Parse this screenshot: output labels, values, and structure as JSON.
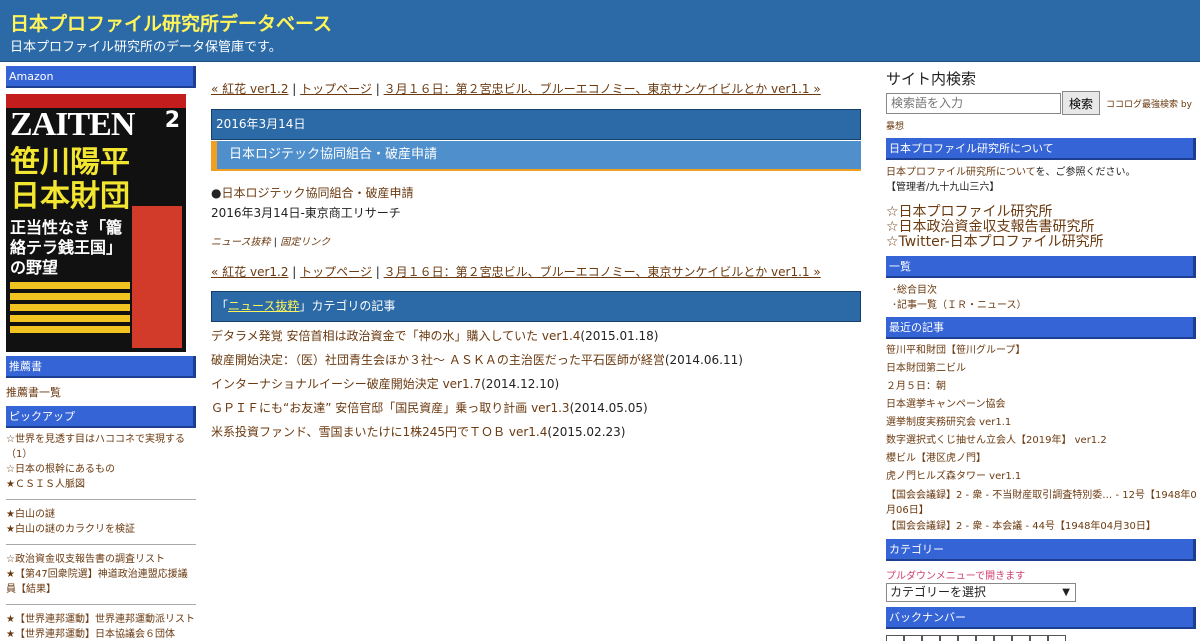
{
  "header": {
    "title": "日本プロファイル研究所データベース",
    "description": "日本プロファイル研究所のデータ保管庫です。"
  },
  "colors": {
    "header_bg": "#2b6aa6",
    "title_yellow": "#fff45a",
    "sidebar_bar": "#3464d6",
    "accent_orange": "#f0a020",
    "link_brown": "#6b3a10"
  },
  "left_sidebar": {
    "amazon_label": "Amazon",
    "magazine": {
      "logo": "ZAITEN",
      "issue": "2",
      "headline_1": "笹川陽平",
      "headline_2": "日本財団",
      "subline": "正当性なき「籠絡テラ銭王国」の野望"
    },
    "recommended_label": "推薦書",
    "recommended_link": "推薦書一覧",
    "pickup_label": "ピックアップ",
    "pickup_group1": [
      "☆世界を見透す目はハココネで実現する（1）",
      "☆日本の根幹にあるもの",
      "★ＣＳＩＳ人脈図"
    ],
    "pickup_group2": [
      "★白山の謎",
      "★白山の謎のカラクリを検証"
    ],
    "pickup_group3": [
      "☆政治資金収支報告書の調査リスト",
      "★【第47回衆院選】神道政治連盟応援議員【結果】"
    ],
    "pickup_group4": [
      "★【世界連邦運動】世界連邦運動派リスト",
      "★【世界連邦運動】日本協議会６団体"
    ]
  },
  "main": {
    "nav": {
      "prev": "« 紅花 ver1.2",
      "sep1": " | ",
      "top": "トップページ",
      "sep2": " | ",
      "next": "３月１６日：第２宮忠ビル、ブルーエコノミー、東京サンケイビルとか ver1.1 »"
    },
    "date": "2016年3月14日",
    "entry_title": "日本ロジテック協同組合・破産申請",
    "entry_bullet": "●",
    "entry_link": "日本ロジテック協同組合・破産申請",
    "entry_source": "2016年3月14日-東京商工リサーチ",
    "meta_category": "ニュース抜粋",
    "meta_sep": " | ",
    "meta_permalink": "固定リンク",
    "category_prefix": "「",
    "category_name": "ニュース抜粋",
    "category_suffix": "」カテゴリの記事",
    "articles": [
      {
        "title": "デタラメ発覚 安倍首相は政治資金で「神の水」購入していた ver1.4",
        "date": "(2015.01.18)"
      },
      {
        "title": "破産開始決定：（医）社団青生会ほか３社～ ＡＳＫＡの主治医だった平石医師が経営",
        "date": "(2014.06.11)"
      },
      {
        "title": "インターナショナルイーシー破産開始決定 ver1.7",
        "date": "(2014.12.10)"
      },
      {
        "title": "ＧＰＩＦにも“お友達” 安倍官邸「国民資産」乗っ取り計画 ver1.3",
        "date": "(2014.05.05)"
      },
      {
        "title": "米系投資ファンド、雪国まいたけに1株245円でＴＯＢ ver1.4",
        "date": "(2015.02.23)"
      }
    ]
  },
  "right_sidebar": {
    "search_title": "サイト内検索",
    "search_placeholder": "検索語を入力",
    "search_button": "検索",
    "powered_a": "ココログ最強検索",
    "powered_b": " by",
    "powered_c": "暴想",
    "about_label": "日本プロファイル研究所について",
    "about_link": "日本プロファイル研究所について",
    "about_text": "を、ご参照ください。",
    "admin": "【管理者/九十九山三六】",
    "big_links": [
      "☆日本プロファイル研究所",
      "☆日本政治資金収支報告書研究所",
      "☆Twitter-日本プロファイル研究所"
    ],
    "list_label": "一覧",
    "list_items": [
      "･総合目次",
      "･記事一覧（ＩＲ・ニュース）"
    ],
    "recent_label": "最近の記事",
    "recent_items": [
      "笹川平和財団【笹川グループ】",
      "日本財団第二ビル",
      "２月５日：朝",
      "日本選挙キャンペーン協会",
      "選挙制度実務研究会 ver1.1",
      "数字選択式くじ抽せん立会人【2019年】 ver1.2",
      "櫻ビル【港区虎ノ門】",
      "虎ノ門ヒルズ森タワー ver1.1",
      "【国会会議録】2 - 衆 - 不当財産取引調査特別委… - 12号【1948年04",
      "月06日】",
      "【国会会議録】2 - 衆 - 本会議 - 44号【1948年04月30日】"
    ],
    "category_label": "カテゴリー",
    "category_note": "プルダウンメニューで開きます",
    "category_select": "カテゴリーを選択",
    "backnumber_label": "バックナンバー"
  }
}
